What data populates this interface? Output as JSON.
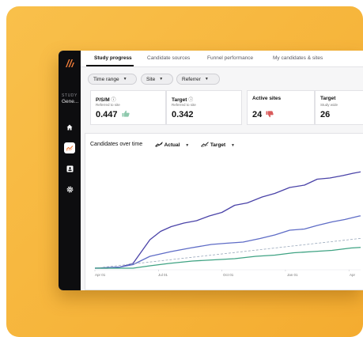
{
  "colors": {
    "backdrop": "#f6b43a",
    "sidebar": "#0d0d0f",
    "accent_orange": "#f07d3a",
    "series_actual": "#4a43a8",
    "series_secondary": "#5e6cc6",
    "series_teal": "#3fa383",
    "series_target": "#98a7ba",
    "thumb_up": "#8ec9ad",
    "thumb_down": "#d95b5b"
  },
  "sidebar": {
    "study_label": "STUDY",
    "study_name": "Gene...",
    "icons": [
      "home-icon",
      "trend-chart-icon",
      "contact-card-icon",
      "gear-icon"
    ],
    "active_icon": "trend-chart-icon"
  },
  "tabs": [
    {
      "label": "Study progress",
      "active": true
    },
    {
      "label": "Candidate sources",
      "active": false
    },
    {
      "label": "Funnel performance",
      "active": false
    },
    {
      "label": "My candidates & sites",
      "active": false
    }
  ],
  "filters": [
    "Time range",
    "Site",
    "Referrer"
  ],
  "kpi_cards": [
    {
      "title": "P/S/M",
      "subtitle": "Referred to site",
      "value": "0.447",
      "indicator": "thumbs-up-icon"
    },
    {
      "title": "Target",
      "subtitle": "Referred to site",
      "value": "0.342"
    },
    {
      "title": "Active sites",
      "subtitle": "",
      "value": "24",
      "indicator": "thumbs-down-icon"
    },
    {
      "title": "Target",
      "subtitle": "Study wide",
      "value": "26"
    }
  ],
  "chart": {
    "title": "Candidates over time",
    "legend": [
      {
        "label": "Actual",
        "icon": "actual-line-icon"
      },
      {
        "label": "Target",
        "icon": "target-line-icon"
      }
    ]
  },
  "chart_data": {
    "type": "line",
    "title": "Candidates over time",
    "x_labels": [
      "Apr 01",
      "Jul 01",
      "Oct 01",
      "Jan 01",
      "Apr"
    ],
    "x_domain": [
      0,
      13
    ],
    "y_domain": [
      0,
      100
    ],
    "grid": false,
    "series": [
      {
        "name": "Actual",
        "style": "solid",
        "color": "#4a43a8",
        "x": [
          0,
          0.6,
          1.2,
          1.8,
          2.2,
          2.6,
          3.1,
          3.6,
          4.2,
          4.8,
          5.4,
          6.0,
          6.6,
          7.2,
          7.9,
          8.5,
          9.2,
          9.9,
          10.5,
          11.1,
          11.7,
          12.2,
          12.8
        ],
        "y": [
          0,
          0,
          1,
          4,
          14,
          24,
          31,
          35,
          38,
          40,
          44,
          47,
          53,
          55,
          60,
          63,
          68,
          70,
          75,
          76,
          78,
          80,
          82
        ]
      },
      {
        "name": "",
        "style": "solid",
        "color": "#5e6cc6",
        "x": [
          0,
          1.2,
          1.8,
          2.6,
          3.6,
          4.5,
          5.5,
          6.2,
          7.0,
          7.8,
          8.5,
          9.2,
          9.9,
          10.5,
          11.2,
          11.8,
          12.5,
          13.0
        ],
        "y": [
          0,
          1,
          3,
          10,
          14,
          17,
          20,
          21,
          22,
          25,
          28,
          32,
          33,
          36,
          39,
          41,
          44,
          45
        ]
      },
      {
        "name": "Target",
        "style": "dashed",
        "color": "#98a7ba",
        "x": [
          0,
          13
        ],
        "y": [
          0,
          26
        ]
      },
      {
        "name": "",
        "style": "solid",
        "color": "#3fa383",
        "x": [
          0,
          1.8,
          2.6,
          3.5,
          4.6,
          5.6,
          6.6,
          7.6,
          8.5,
          9.4,
          10.3,
          11.2,
          12.1,
          13.0
        ],
        "y": [
          0,
          0,
          2,
          4,
          6,
          7,
          8,
          10,
          11,
          13,
          14,
          15,
          17,
          18
        ]
      }
    ]
  }
}
